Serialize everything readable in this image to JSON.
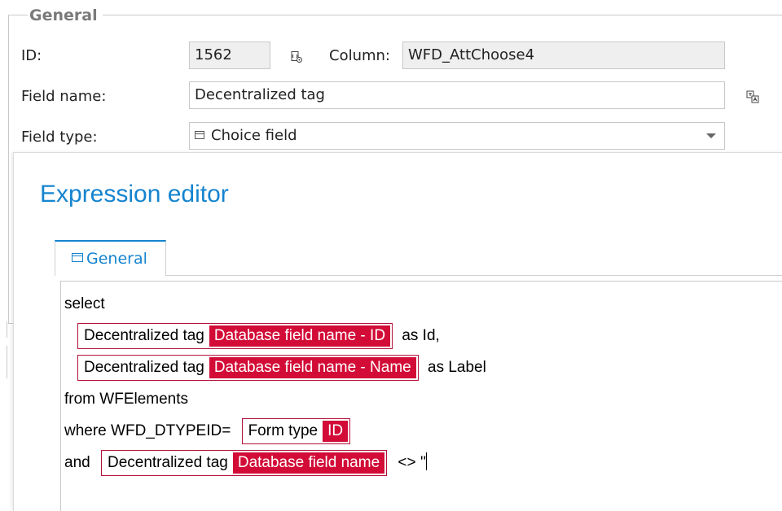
{
  "general_group": {
    "title": "General",
    "id_label": "ID:",
    "id_value": "1562",
    "column_label": "Column:",
    "column_value": "WFD_AttChoose4",
    "field_name_label": "Field name:",
    "field_name_value": "Decentralized tag",
    "field_type_label": "Field type:",
    "field_type_value": "Choice field"
  },
  "editor": {
    "title": "Expression editor",
    "tabs": [
      {
        "label": "General"
      }
    ],
    "lines": [
      {
        "pre": "select"
      },
      {
        "pre": "",
        "token_name": "Decentralized tag",
        "token_attr": "Database field name - ID",
        "post": "as Id,"
      },
      {
        "pre": "",
        "token_name": "Decentralized tag",
        "token_attr": "Database field name - Name",
        "post": "as Label"
      },
      {
        "pre": "from WFElements"
      },
      {
        "pre": "where WFD_DTYPEID=",
        "token_name": "Form type",
        "token_attr": "ID",
        "post": ""
      },
      {
        "pre": "and",
        "token_name": "Decentralized tag",
        "token_attr": "Database field name",
        "post": "<> ''"
      }
    ]
  },
  "colors": {
    "accent": "#1584cf",
    "token_red": "#d20c37"
  },
  "icons": {
    "id_icon": "copy-code-icon",
    "field_name_icon": "translate-icon",
    "field_type_icon": "choice-field-icon",
    "dropdown_icon": "chevron-down-icon"
  }
}
